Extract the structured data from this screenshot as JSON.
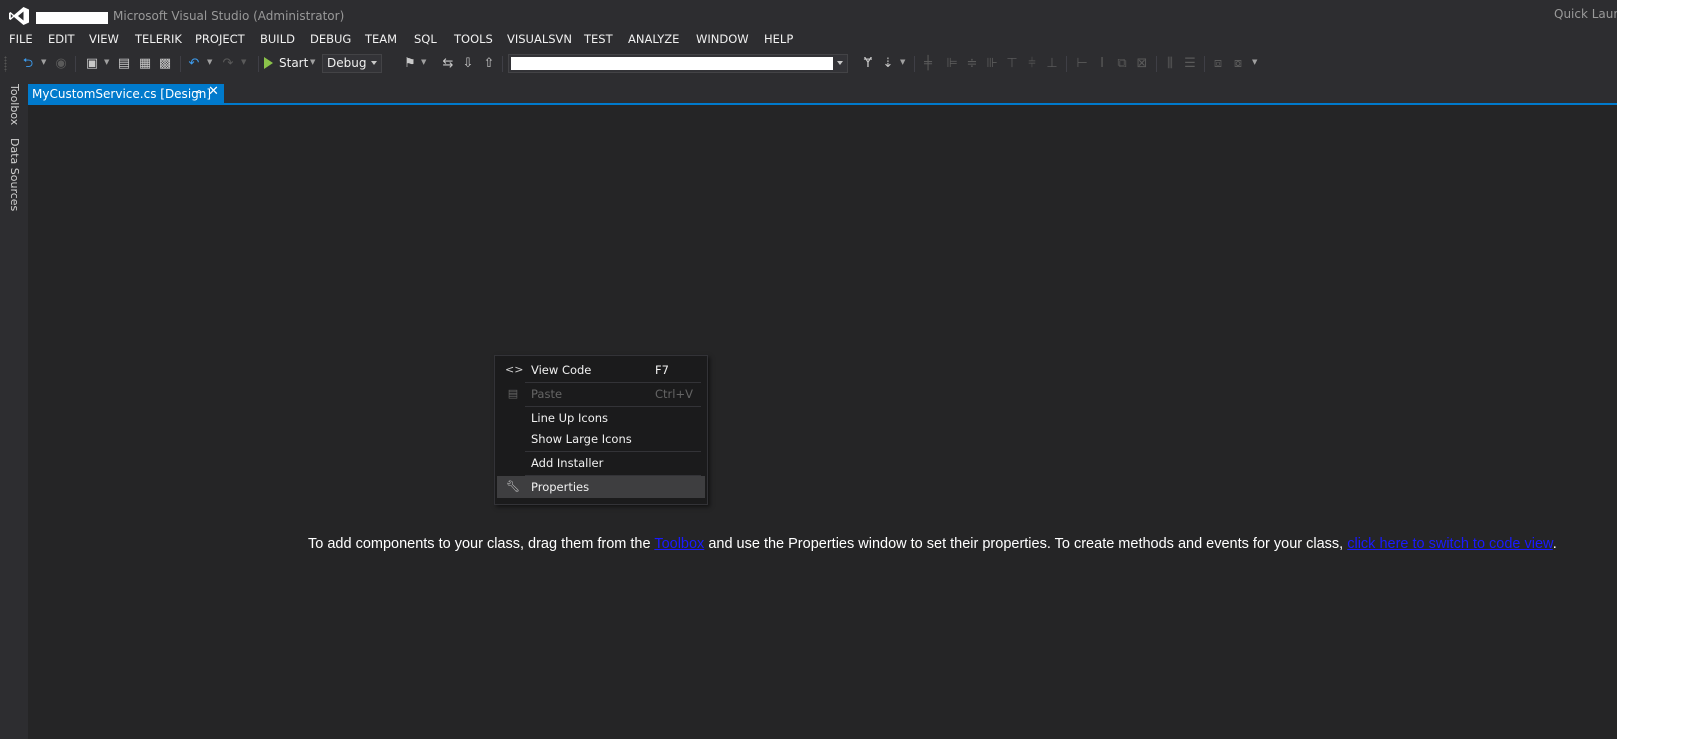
{
  "title": {
    "app": "Microsoft Visual Studio (Administrator)",
    "quick_launch": "Quick Launch"
  },
  "menu": [
    "FILE",
    "EDIT",
    "VIEW",
    "TELERIK",
    "PROJECT",
    "BUILD",
    "DEBUG",
    "TEAM",
    "SQL",
    "TOOLS",
    "VISUALSVN",
    "TEST",
    "ANALYZE",
    "WINDOW",
    "HELP"
  ],
  "toolbar": {
    "start_label": "Start",
    "configuration": "Debug"
  },
  "dock": {
    "toolbox": "Toolbox",
    "data_sources": "Data Sources"
  },
  "document": {
    "tab_title": "MyCustomService.cs [Design]"
  },
  "context_menu": {
    "items": [
      {
        "icon": "code-icon",
        "label": "View Code",
        "shortcut": "F7",
        "enabled": true
      },
      {
        "icon": "paste-icon",
        "label": "Paste",
        "shortcut": "Ctrl+V",
        "enabled": false
      },
      {
        "label": "Line Up Icons",
        "shortcut": "",
        "enabled": true
      },
      {
        "label": "Show Large Icons",
        "shortcut": "",
        "enabled": true
      },
      {
        "label": "Add Installer",
        "shortcut": "",
        "enabled": true
      },
      {
        "icon": "wrench-icon",
        "label": "Properties",
        "shortcut": "",
        "enabled": true,
        "highlighted": true
      }
    ]
  },
  "hint": {
    "before": "To add components to your class, drag them from the ",
    "toolbox_link": "Toolbox",
    "middle": " and use the Properties window to set their properties. To create methods and events for your class, ",
    "code_link": "click here to switch to code view",
    "after": "."
  },
  "colors": {
    "accent": "#007acc",
    "background": "#2d2d30",
    "surface": "#252526",
    "link": "#1a1aff"
  }
}
